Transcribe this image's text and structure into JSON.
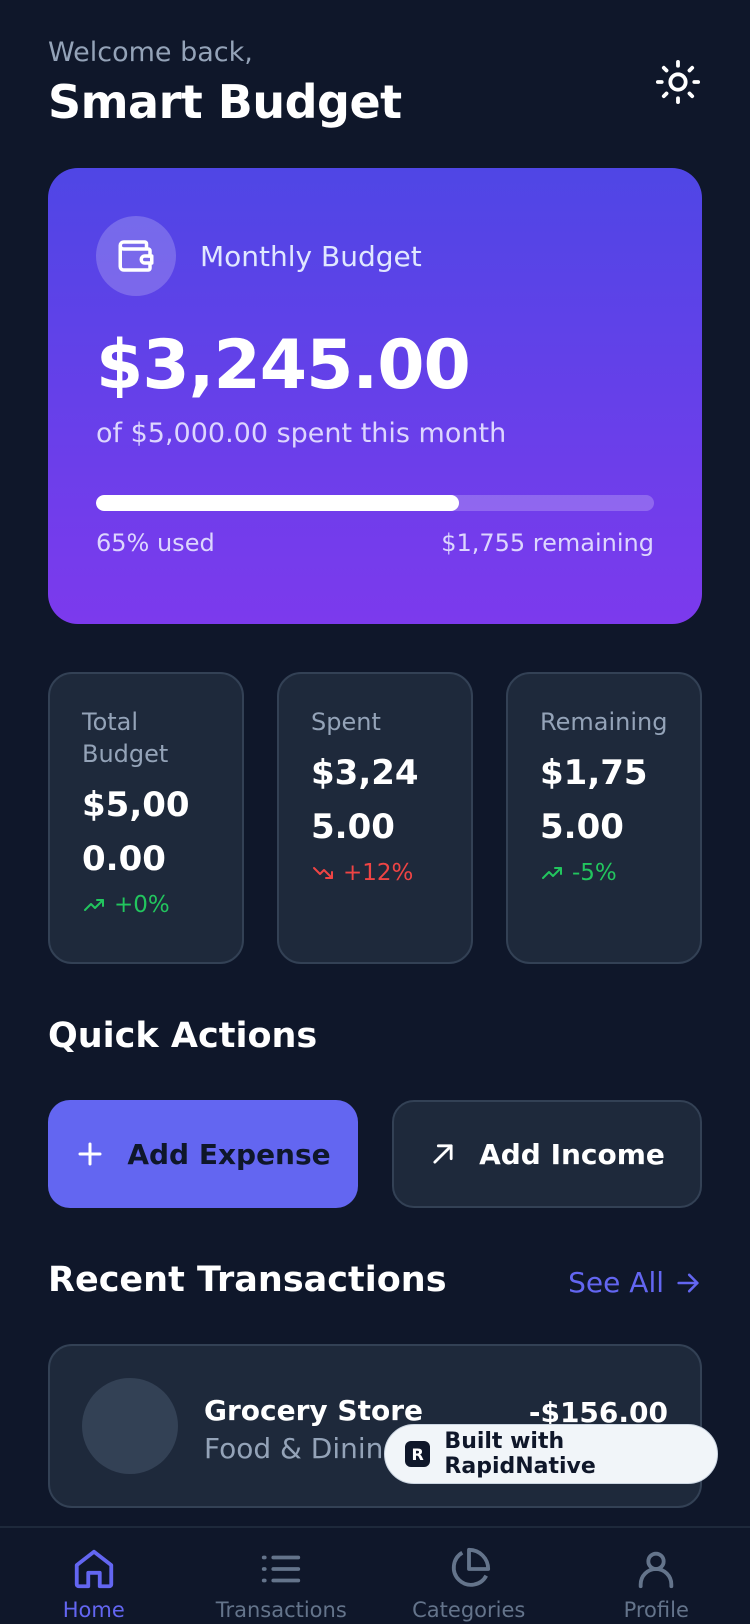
{
  "header": {
    "welcome": "Welcome back,",
    "title": "Smart Budget",
    "theme_icon": "sun-icon"
  },
  "budget_card": {
    "label": "Monthly Budget",
    "amount": "$3,245.00",
    "subtitle": "of $5,000.00 spent this month",
    "progress_percent": 65,
    "used_label": "65% used",
    "remaining_label": "$1,755 remaining",
    "icon": "wallet-icon"
  },
  "stats": [
    {
      "label": "Total Budget",
      "value": "$5,000.00",
      "change": "+0%",
      "trend": "up"
    },
    {
      "label": "Spent",
      "value": "$3,245.00",
      "change": "+12%",
      "trend": "down"
    },
    {
      "label": "Remaining",
      "value": "$1,755.00",
      "change": "-5%",
      "trend": "up"
    }
  ],
  "quick_actions": {
    "title": "Quick Actions",
    "add_expense": "Add Expense",
    "add_income": "Add Income"
  },
  "recent": {
    "title": "Recent Transactions",
    "see_all": "See All",
    "transactions": [
      {
        "name": "Grocery Store",
        "category": "Food & Dining",
        "amount": "-$156.00"
      }
    ]
  },
  "badge": {
    "text": "Built with RapidNative"
  },
  "tabs": [
    {
      "label": "Home",
      "icon": "home-icon"
    },
    {
      "label": "Transactions",
      "icon": "list-icon"
    },
    {
      "label": "Categories",
      "icon": "pie-chart-icon"
    },
    {
      "label": "Profile",
      "icon": "user-icon"
    }
  ],
  "colors": {
    "background": "#0f172a",
    "card": "#1e293b",
    "accent": "#6366f1",
    "gradient_start": "#4f46e5",
    "gradient_end": "#7c3aed",
    "positive": "#22c55e",
    "negative": "#ef4444"
  }
}
